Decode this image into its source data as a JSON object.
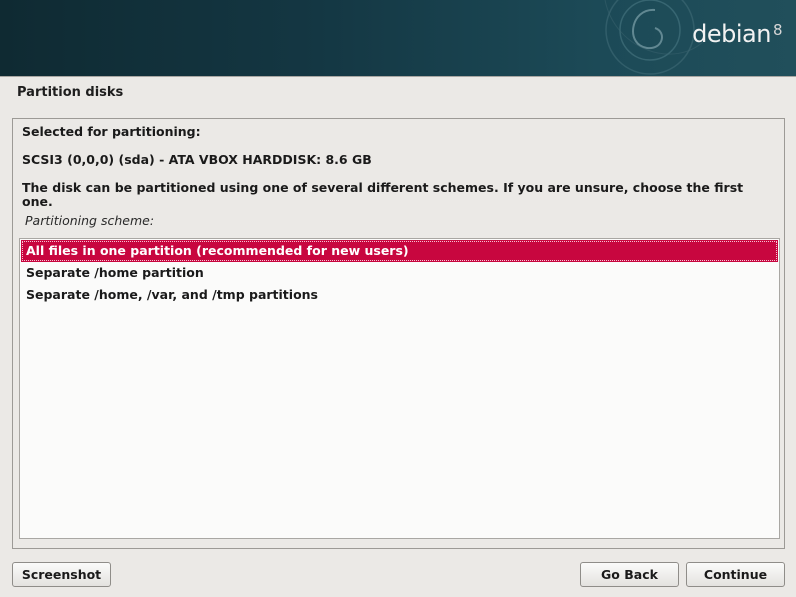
{
  "banner": {
    "brand": "debian",
    "version": "8"
  },
  "page": {
    "title": "Partition disks"
  },
  "content": {
    "selected_label": "Selected for partitioning:",
    "disk": "SCSI3 (0,0,0) (sda) - ATA VBOX HARDDISK: 8.6 GB",
    "description": "The disk can be partitioned using one of several different schemes. If you are unsure, choose the first one.",
    "scheme_label": "Partitioning scheme:"
  },
  "schemes": [
    "All files in one partition (recommended for new users)",
    "Separate /home partition",
    "Separate /home, /var, and /tmp partitions"
  ],
  "selected_scheme_index": 0,
  "buttons": {
    "screenshot": "Screenshot",
    "go_back": "Go Back",
    "continue": "Continue"
  },
  "colors": {
    "selection": "#c8063f",
    "banner": "#143743"
  }
}
